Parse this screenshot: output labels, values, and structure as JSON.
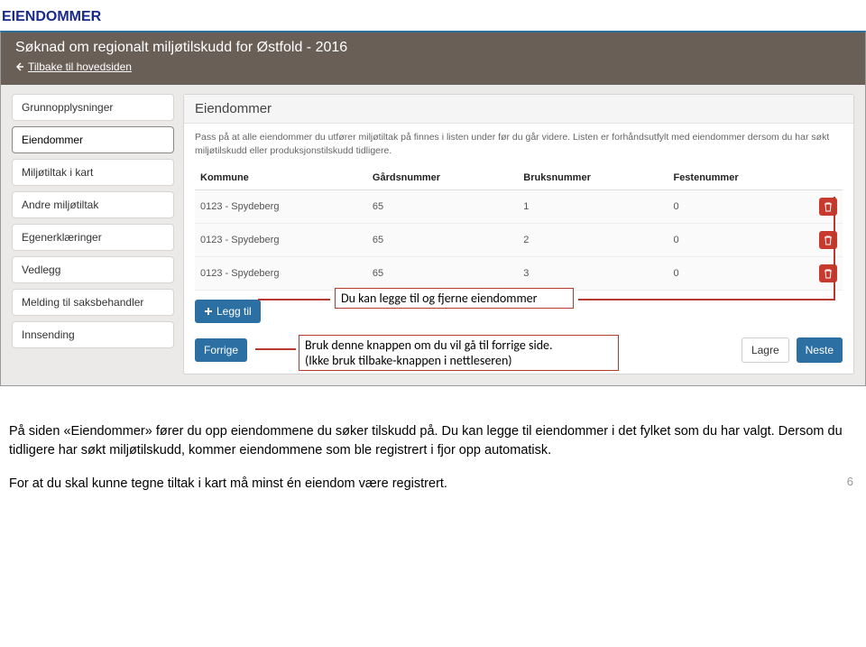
{
  "doc": {
    "title": "EIENDOMMER",
    "page_number": "6"
  },
  "app": {
    "title": "Søknad om regionalt miljøtilskudd for Østfold - 2016",
    "back_label": "Tilbake til hovedsiden"
  },
  "sidebar": {
    "items": [
      {
        "label": "Grunnopplysninger"
      },
      {
        "label": "Eiendommer"
      },
      {
        "label": "Miljøtiltak i kart"
      },
      {
        "label": "Andre miljøtiltak"
      },
      {
        "label": "Egenerklæringer"
      },
      {
        "label": "Vedlegg"
      },
      {
        "label": "Melding til saksbehandler"
      },
      {
        "label": "Innsending"
      }
    ],
    "active_index": 1
  },
  "panel": {
    "title": "Eiendommer",
    "hint": "Pass på at alle eiendommer du utfører miljøtiltak på finnes i listen under før du går videre. Listen er forhåndsutfylt med eiendommer dersom du har søkt miljøtilskudd eller produksjonstilskudd tidligere.",
    "columns": [
      "Kommune",
      "Gårdsnummer",
      "Bruksnummer",
      "Festenummer"
    ],
    "rows": [
      {
        "kommune": "0123 - Spydeberg",
        "gard": "65",
        "bruk": "1",
        "feste": "0"
      },
      {
        "kommune": "0123 - Spydeberg",
        "gard": "65",
        "bruk": "2",
        "feste": "0"
      },
      {
        "kommune": "0123 - Spydeberg",
        "gard": "65",
        "bruk": "3",
        "feste": "0"
      }
    ],
    "add_label": "Legg til",
    "prev_label": "Forrige",
    "save_label": "Lagre",
    "next_label": "Neste"
  },
  "annotations": {
    "callout_add": "Du kan legge til og fjerne eiendommer",
    "callout_prev1": "Bruk denne knappen om du vil gå til forrige side.",
    "callout_prev2": "(Ikke bruk tilbake-knappen i nettleseren)",
    "body_text": "På siden «Eiendommer» fører du opp eiendommene du søker tilskudd på. Du kan legge til eiendommer i det fylket som du har valgt. Dersom du tidligere har søkt miljøtilskudd, kommer eiendommene som ble registrert i fjor opp automatisk.",
    "body_text2": "For at du skal kunne tegne tiltak i kart må minst én eiendom være registrert."
  }
}
